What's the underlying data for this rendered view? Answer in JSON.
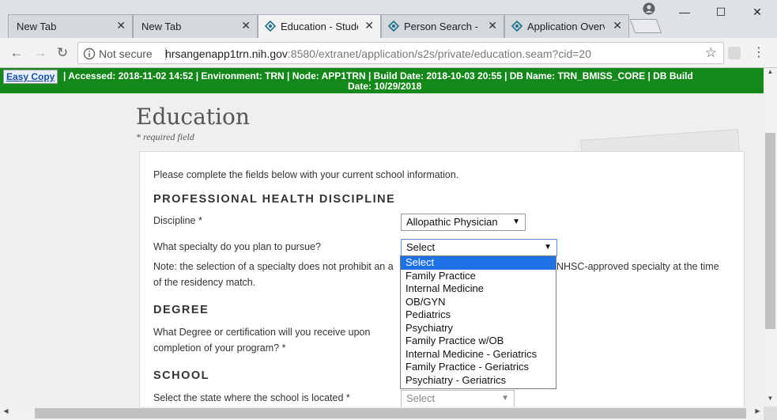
{
  "browser": {
    "tabs": [
      {
        "title": "New Tab",
        "icon": ""
      },
      {
        "title": "New Tab",
        "icon": ""
      },
      {
        "title": "Education - Studer",
        "icon": "hrsa-logo-icon"
      },
      {
        "title": "Person Search - BI",
        "icon": "hrsa-logo-icon"
      },
      {
        "title": "Application Overv",
        "icon": "hrsa-logo-icon"
      }
    ],
    "window_controls": {
      "minimize": "—",
      "maximize": "☐",
      "close": "✕"
    },
    "toolbar": {
      "back": "←",
      "forward": "→",
      "reload": "↻",
      "security_label": "Not secure",
      "url_host": "hrsangenapp1trn.nih.gov",
      "url_rest": ":8580/extranet/application/s2s/private/education.seam?cid=20",
      "star": "☆",
      "menu": "⋮"
    }
  },
  "env_banner": {
    "copy_label": "Easy Copy",
    "line1": "|   Accessed: 2018-11-02 14:52   |   Environment: TRN   |   Node: APP1TRN   |   Build Date: 2018-10-03 20:55   |   DB Name: TRN_BMISS_CORE   |   DB Build",
    "line2": "Date: 10/29/2018"
  },
  "page": {
    "title": "Education",
    "required_note": "* required field",
    "intro": "Please complete the fields below with your current school information.",
    "sections": {
      "discipline_head": "PROFESSIONAL HEALTH DISCIPLINE",
      "degree_head": "DEGREE",
      "school_head": "SCHOOL"
    },
    "discipline_label": "Discipline *",
    "discipline_value": "Allopathic Physician",
    "specialty_label": "What specialty do you plan to pursue?",
    "specialty_value": "Select",
    "note_line1_left": "Note: the selection of a specialty does not prohibit an a",
    "note_line1_right": "NHSC-approved specialty at the time",
    "note_line2": "of the residency match.",
    "degree_line1": "What Degree or certification will you receive upon",
    "degree_line2": "completion of your program? *",
    "state_label": "Select the state where the school is located *",
    "state_value": "Select",
    "specialty_options": [
      "Select",
      "Family Practice",
      "Internal Medicine",
      "OB/GYN",
      "Pediatrics",
      "Psychiatry",
      "Family Practice w/OB",
      "Internal Medicine - Geriatrics",
      "Family Practice - Geriatrics",
      "Psychiatry - Geriatrics"
    ],
    "selected_option_index": 0
  },
  "colors": {
    "env_banner": "#14881a",
    "selection": "#1e72e6"
  }
}
